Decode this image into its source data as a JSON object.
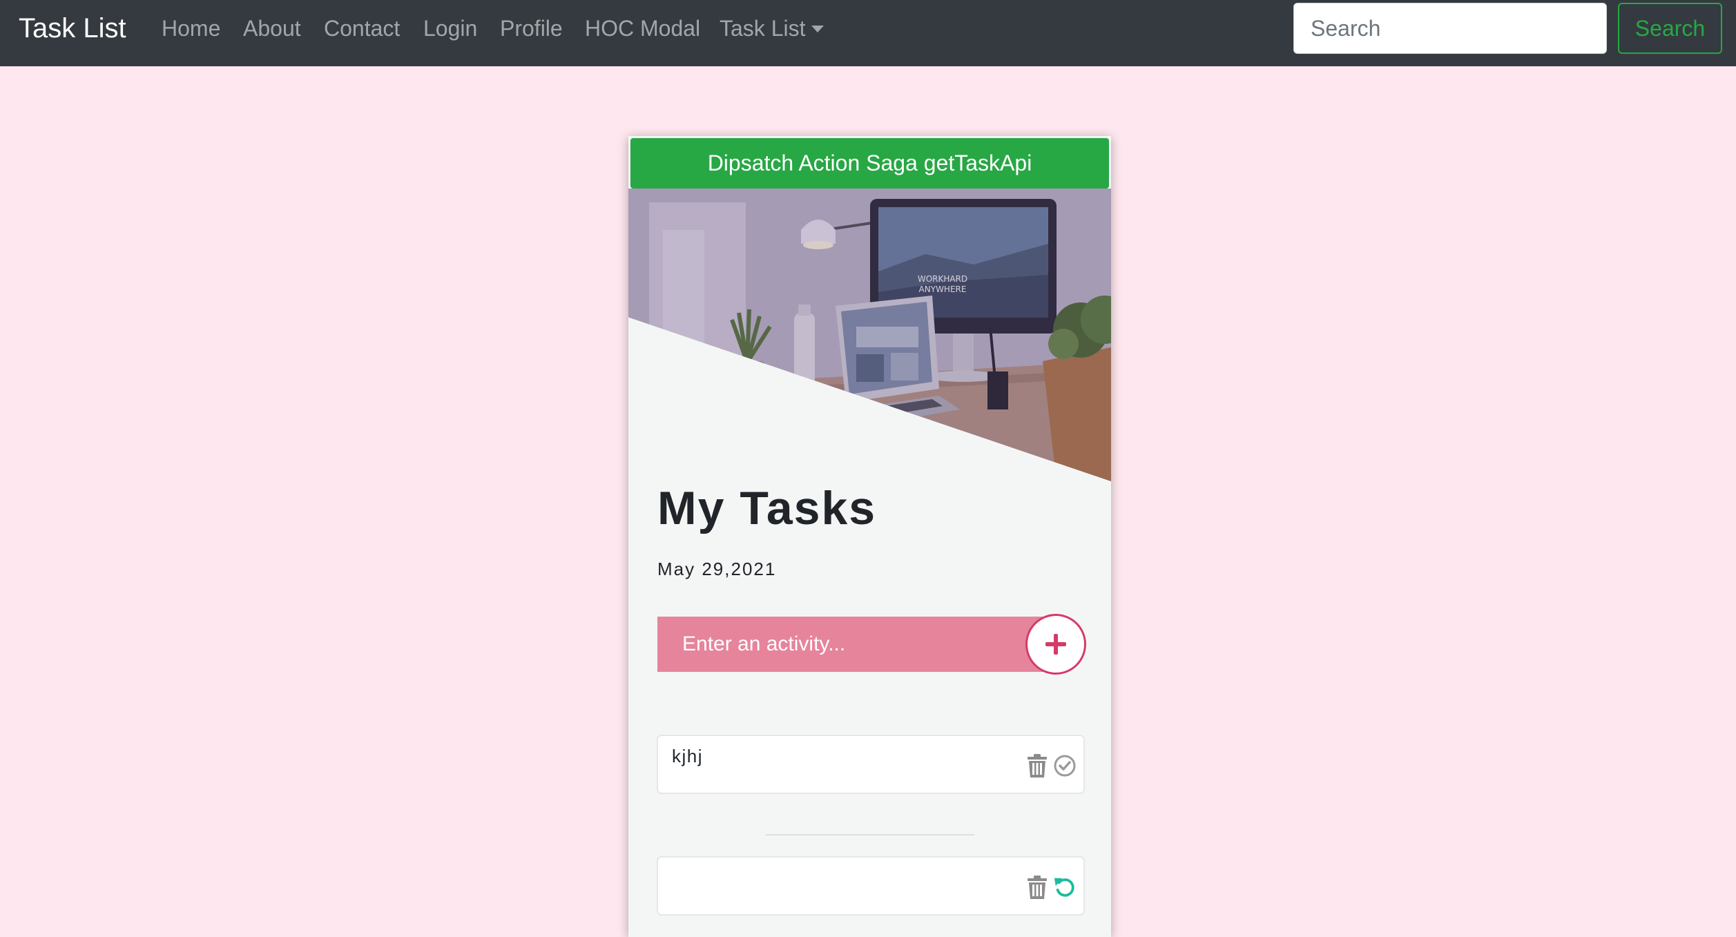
{
  "navbar": {
    "brand": "Task List",
    "links": [
      "Home",
      "About",
      "Contact",
      "Login",
      "Profile",
      "HOC Modal"
    ],
    "dropdown_label": "Task List",
    "search": {
      "placeholder": "Search",
      "value": ""
    },
    "search_button": "Search"
  },
  "card": {
    "dispatch_button": "Dipsatch Action Saga getTaskApi",
    "hero_image": {
      "screen_text": [
        "WORKHARD",
        "ANYWHERE"
      ]
    },
    "title": "My Tasks",
    "date": "May 29,2021",
    "activity_input": {
      "placeholder": "Enter an activity...",
      "value": ""
    },
    "pending_tasks": [
      {
        "text": "kjhj"
      }
    ],
    "completed_tasks": [
      {
        "text": ""
      }
    ]
  },
  "colors": {
    "page_bg": "#fee7ee",
    "navbar_bg": "#343a40",
    "success": "#28a745",
    "activity_input_bg": "#e6849c",
    "add_accent": "#d63a67",
    "undo_accent": "#1abc9c"
  },
  "icons": [
    "plus-icon",
    "trash-icon",
    "check-circle-icon",
    "undo-icon",
    "caret-down-icon"
  ]
}
